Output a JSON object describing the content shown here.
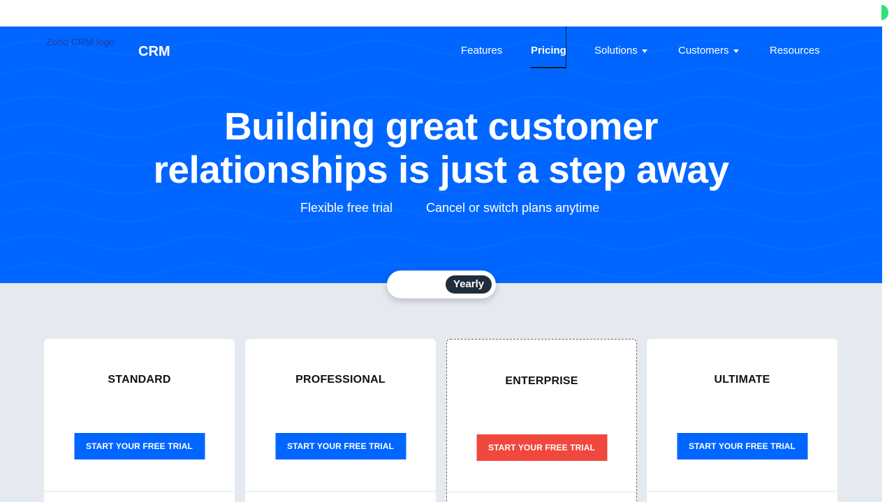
{
  "brand": {
    "logo_alt": "Zoho CRM logo",
    "logo_text": "CRM"
  },
  "nav": {
    "features": "Features",
    "pricing": "Pricing",
    "solutions": "Solutions",
    "customers": "Customers",
    "resources": "Resources"
  },
  "hero": {
    "title_line1": "Building great customer",
    "title_line2": "relationships is just a step away",
    "sub_left": "Flexible free trial",
    "sub_right": "Cancel or switch plans anytime"
  },
  "billing_toggle": {
    "selected": "Yearly"
  },
  "plans": [
    {
      "name": "STANDARD",
      "cta": "START YOUR FREE TRIAL"
    },
    {
      "name": "PROFESSIONAL",
      "cta": "START YOUR FREE TRIAL"
    },
    {
      "name": "ENTERPRISE",
      "cta": "START YOUR FREE TRIAL"
    },
    {
      "name": "ULTIMATE",
      "cta": "START YOUR FREE TRIAL"
    }
  ],
  "colors": {
    "hero_blue": "#0066ff",
    "cta_blue": "#0066ff",
    "cta_highlight_red": "#f0483e",
    "content_bg": "#e5e9f0",
    "toggle_pill": "#1f2d3d"
  }
}
